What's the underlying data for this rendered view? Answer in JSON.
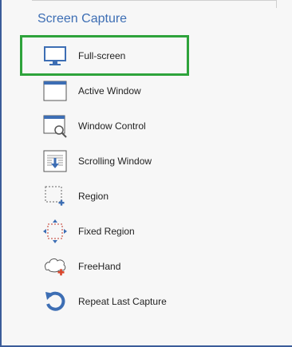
{
  "section": {
    "title": "Screen Capture"
  },
  "menu": {
    "items": [
      {
        "label": "Full-screen",
        "icon": "monitor-icon"
      },
      {
        "label": "Active Window",
        "icon": "window-icon"
      },
      {
        "label": "Window Control",
        "icon": "window-control-icon"
      },
      {
        "label": "Scrolling Window",
        "icon": "scrolling-window-icon"
      },
      {
        "label": "Region",
        "icon": "region-icon"
      },
      {
        "label": "Fixed Region",
        "icon": "fixed-region-icon"
      },
      {
        "label": "FreeHand",
        "icon": "freehand-icon"
      },
      {
        "label": "Repeat Last Capture",
        "icon": "repeat-icon"
      }
    ],
    "selected_index": 0
  },
  "colors": {
    "accent": "#3d6eb4",
    "highlight": "#2ea33b",
    "add_mark": "#d9452b"
  }
}
